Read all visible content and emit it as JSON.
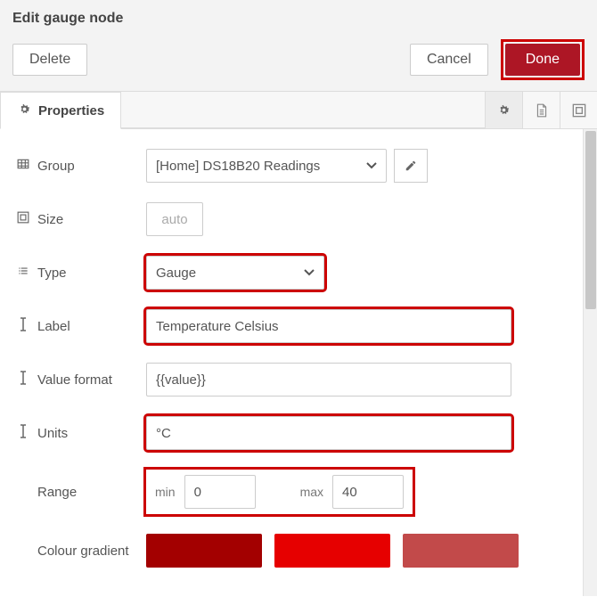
{
  "header": {
    "title": "Edit gauge node",
    "delete": "Delete",
    "cancel": "Cancel",
    "done": "Done"
  },
  "tabs": {
    "properties": "Properties"
  },
  "labels": {
    "group": "Group",
    "size": "Size",
    "type": "Type",
    "label": "Label",
    "value_format": "Value format",
    "units": "Units",
    "range": "Range",
    "colour_gradient": "Colour gradient",
    "min": "min",
    "max": "max"
  },
  "values": {
    "group_selected": "[Home] DS18B20 Readings",
    "size": "auto",
    "type_selected": "Gauge",
    "label": "Temperature Celsius",
    "value_format": "{{value}}",
    "units": "°C",
    "range_min": "0",
    "range_max": "40"
  },
  "colors": {
    "c1": "#a30000",
    "c2": "#e60000",
    "c3": "#c24a4a"
  }
}
